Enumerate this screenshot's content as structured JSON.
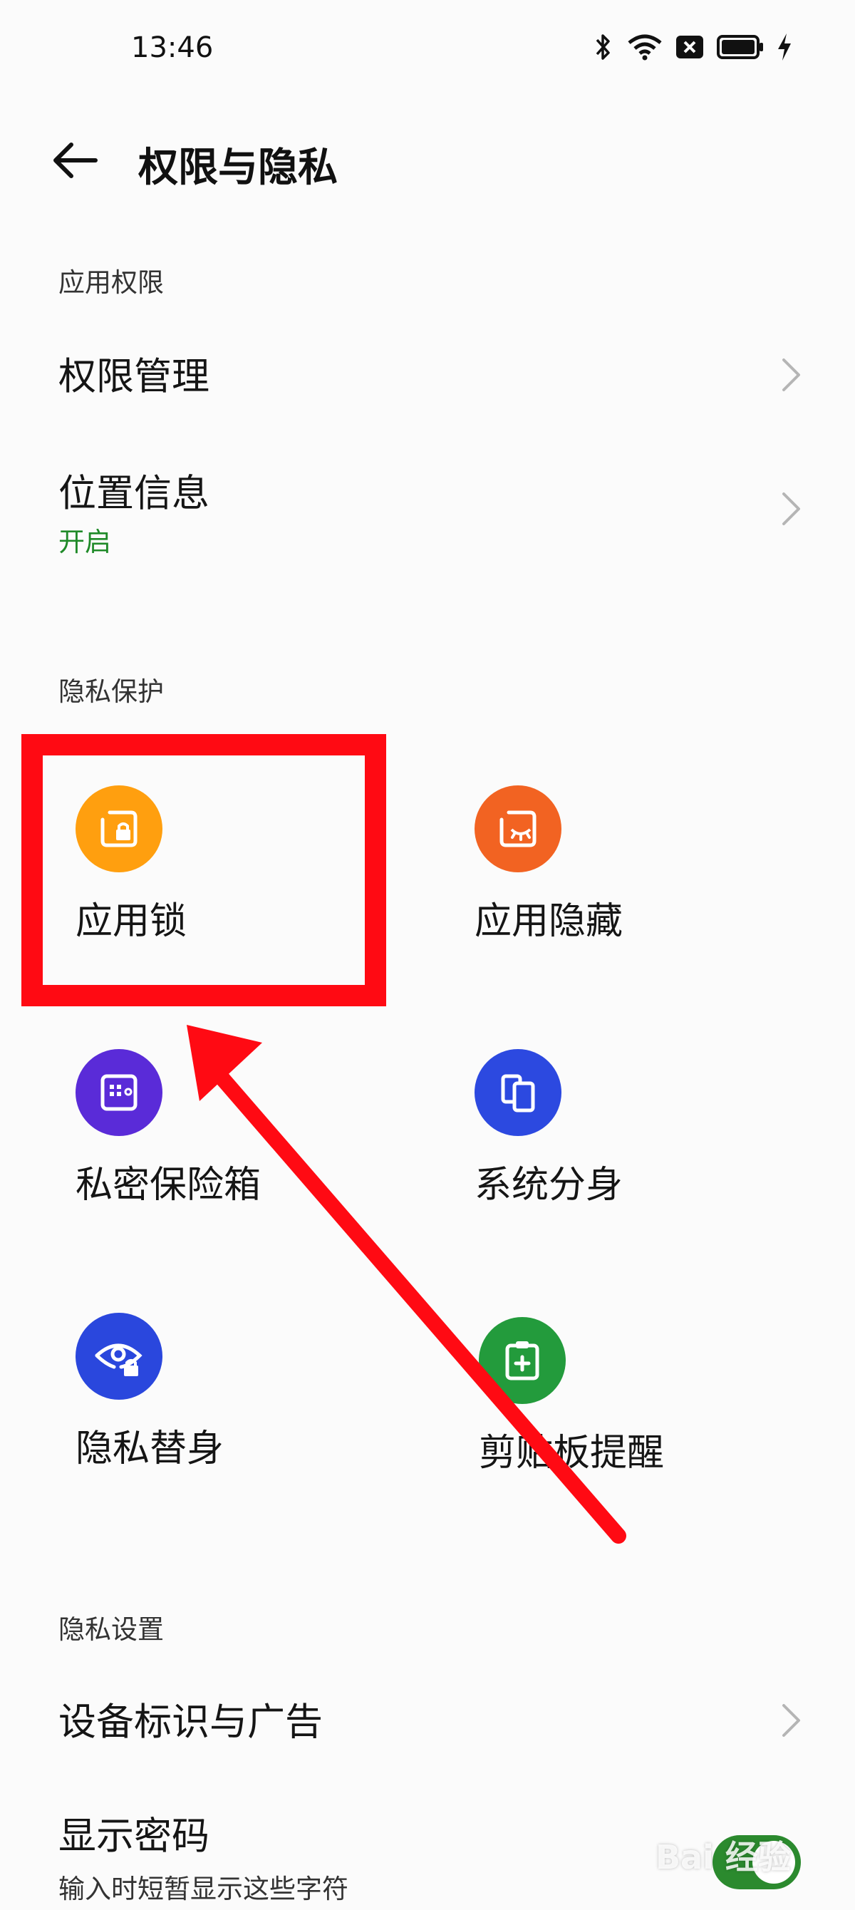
{
  "status_bar": {
    "time": "13:46",
    "icons": [
      "bluetooth-icon",
      "wifi-icon",
      "notification-icon",
      "battery-icon",
      "charging-icon"
    ]
  },
  "header": {
    "back_icon": "arrow-left-icon",
    "title": "权限与隐私"
  },
  "sections": {
    "app_permissions": {
      "label": "应用权限",
      "rows": [
        {
          "title": "权限管理",
          "subtitle": ""
        },
        {
          "title": "位置信息",
          "subtitle": "开启"
        }
      ]
    },
    "privacy_protection": {
      "label": "隐私保护",
      "items": [
        {
          "label": "应用锁",
          "icon": "app-lock-icon",
          "color": "#ff9f0f"
        },
        {
          "label": "应用隐藏",
          "icon": "app-hide-icon",
          "color": "#f26322"
        },
        {
          "label": "私密保险箱",
          "icon": "safe-icon",
          "color": "#5a2bd8"
        },
        {
          "label": "系统分身",
          "icon": "clone-icon",
          "color": "#2c49e0"
        },
        {
          "label": "隐私替身",
          "icon": "privacy-eye-icon",
          "color": "#2a47dd"
        },
        {
          "label": "剪贴板提醒",
          "icon": "clipboard-icon",
          "color": "#239b3c"
        }
      ]
    },
    "privacy_settings": {
      "label": "隐私设置",
      "rows": [
        {
          "title": "设备标识与广告",
          "subtitle": ""
        },
        {
          "title": "显示密码",
          "subtitle": "输入时短暂显示这些字符",
          "toggle_on": true
        }
      ]
    }
  },
  "colors": {
    "accent_green": "#1f8a28",
    "highlight_red": "#ff0a13"
  },
  "watermark": "Bai 经验"
}
